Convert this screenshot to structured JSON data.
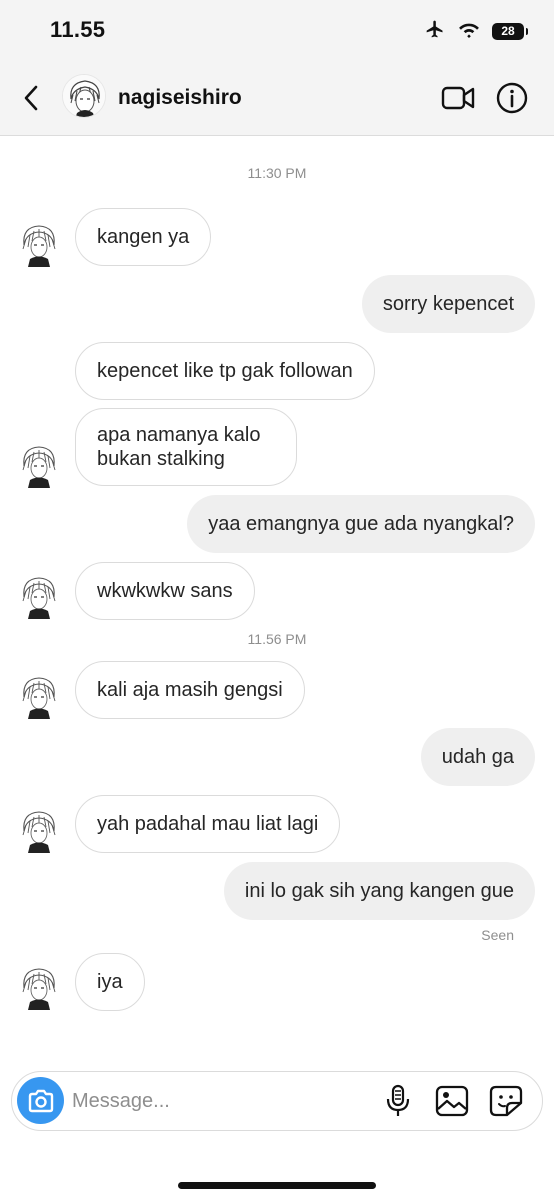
{
  "status_bar": {
    "time": "11.55",
    "battery": "28"
  },
  "header": {
    "username": "nagiseishiro"
  },
  "timestamps": [
    "11:30 PM",
    "11.56 PM"
  ],
  "messages": [
    {
      "from": "them",
      "text": "kangen ya"
    },
    {
      "from": "me",
      "text": "sorry kepencet"
    },
    {
      "from": "them",
      "text": "kepencet like tp gak followan"
    },
    {
      "from": "them",
      "text": "apa namanya kalo bukan stalking"
    },
    {
      "from": "me",
      "text": "yaa emangnya gue ada nyangkal?"
    },
    {
      "from": "them",
      "text": "wkwkwkw sans"
    },
    {
      "from": "them",
      "text": "kali aja masih gengsi"
    },
    {
      "from": "me",
      "text": "udah ga"
    },
    {
      "from": "them",
      "text": "yah padahal mau liat lagi"
    },
    {
      "from": "me",
      "text": "ini lo gak sih yang kangen gue"
    },
    {
      "from": "them",
      "text": "iya"
    }
  ],
  "seen_label": "Seen",
  "composer": {
    "placeholder": "Message..."
  },
  "colors": {
    "accent": "#3797f0",
    "incoming_border": "#dbdbdb",
    "outgoing_bg": "#efefef",
    "header_bg": "#f4f4f4"
  },
  "icons": [
    "airplane-icon",
    "wifi-icon",
    "battery-icon",
    "back-chevron-icon",
    "video-camera-icon",
    "info-icon",
    "camera-icon",
    "microphone-icon",
    "gallery-icon",
    "sticker-icon"
  ]
}
